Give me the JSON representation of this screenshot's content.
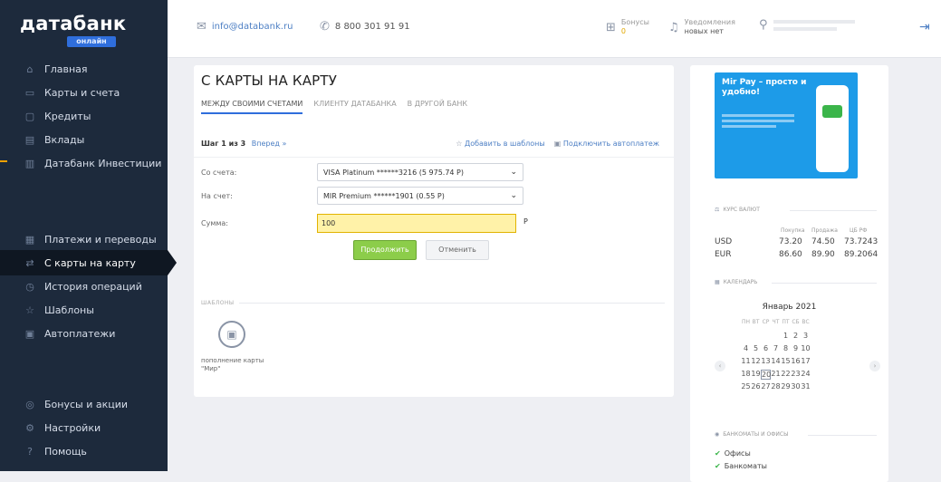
{
  "brand": {
    "name": "датабанк",
    "badge": "онлайн"
  },
  "sidebar": {
    "items": [
      {
        "label": "Главная",
        "icon": "home-icon",
        "glyph": "⌂"
      },
      {
        "label": "Карты и счета",
        "icon": "card-icon",
        "glyph": "▭"
      },
      {
        "label": "Кредиты",
        "icon": "credit-icon",
        "glyph": "▢"
      },
      {
        "label": "Вклады",
        "icon": "deposit-icon",
        "glyph": "▤"
      },
      {
        "label": "Датабанк Инвестиции",
        "icon": "invest-icon",
        "glyph": "▥"
      }
    ],
    "items2": [
      {
        "label": "Платежи и переводы",
        "icon": "payments-icon",
        "glyph": "▦"
      },
      {
        "label": "С карты на карту",
        "icon": "card-to-card-icon",
        "glyph": "⇄"
      },
      {
        "label": "История операций",
        "icon": "history-icon",
        "glyph": "◷"
      },
      {
        "label": "Шаблоны",
        "icon": "star-icon",
        "glyph": "☆"
      },
      {
        "label": "Автоплатежи",
        "icon": "autopay-icon",
        "glyph": "▣"
      }
    ],
    "items3": [
      {
        "label": "Бонусы и акции",
        "icon": "bonus-icon",
        "glyph": "◎"
      },
      {
        "label": "Настройки",
        "icon": "settings-icon",
        "glyph": "⚙"
      },
      {
        "label": "Помощь",
        "icon": "help-icon",
        "glyph": "?"
      }
    ]
  },
  "header": {
    "email": "info@databank.ru",
    "phone": "8 800 301 91 91",
    "bonus_label": "Бонусы",
    "bonus_value": "0",
    "notif_label": "Уведомления",
    "notif_value": "новых нет"
  },
  "transfer": {
    "title": "С КАРТЫ НА КАРТУ",
    "tabs": [
      "МЕЖДУ СВОИМИ СЧЕТАМИ",
      "КЛИЕНТУ ДАТАБАНКА",
      "В ДРУГОЙ БАНК"
    ],
    "step": "Шаг 1 из 3",
    "next_step": "Вперед »",
    "add_template": "Добавить в шаблоны",
    "autopay": "Подключить автоплатеж",
    "from_label": "Со счета:",
    "from_value": "VISA Platinum ******3216 (5 975.74 Р)",
    "to_label": "На счет:",
    "to_value": "MIR Premium ******1901 (0.55 Р)",
    "sum_label": "Сумма:",
    "sum_value": "100",
    "currency": "Р",
    "continue": "Продолжить",
    "cancel": "Отменить",
    "templates_label": "ШАБЛОНЫ",
    "template_name": "пополнение карты \"Мир\""
  },
  "banner": {
    "title": "Mir Pay – просто и удобно!"
  },
  "rates": {
    "section": "КУРС ВАЛЮТ",
    "cols": [
      "Покупка",
      "Продажа",
      "ЦБ РФ"
    ],
    "rows": [
      {
        "cur": "USD",
        "buy": "73.20",
        "sell": "74.50",
        "cb": "73.7243"
      },
      {
        "cur": "EUR",
        "buy": "86.60",
        "sell": "89.90",
        "cb": "89.2064"
      }
    ]
  },
  "calendar": {
    "section": "КАЛЕНДАРЬ",
    "month": "Январь 2021",
    "weekdays": [
      "ПН",
      "ВТ",
      "СР",
      "ЧТ",
      "ПТ",
      "СБ",
      "ВС"
    ],
    "weeks": [
      [
        "",
        "",
        "",
        "",
        "1",
        "2",
        "3"
      ],
      [
        "4",
        "5",
        "6",
        "7",
        "8",
        "9",
        "10"
      ],
      [
        "11",
        "12",
        "13",
        "14",
        "15",
        "16",
        "17"
      ],
      [
        "18",
        "19",
        "20",
        "21",
        "22",
        "23",
        "24"
      ],
      [
        "25",
        "26",
        "27",
        "28",
        "29",
        "30",
        "31"
      ]
    ],
    "today": "20"
  },
  "offices": {
    "section": "БАНКОМАТЫ И ОФИСЫ",
    "items": [
      "Офисы",
      "Банкоматы"
    ]
  }
}
